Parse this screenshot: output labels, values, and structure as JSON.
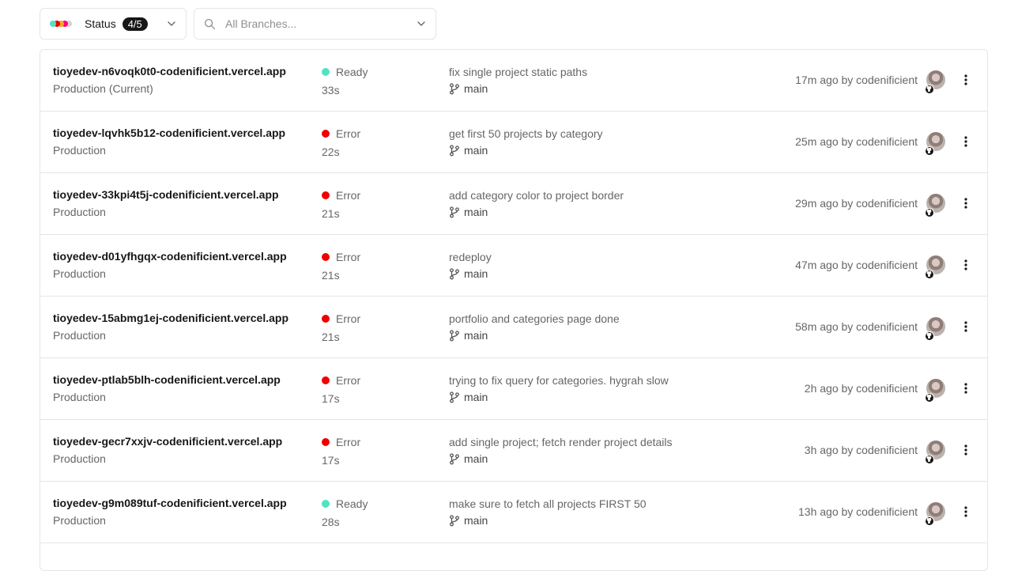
{
  "filters": {
    "status": {
      "label": "Status",
      "count": "4/5",
      "dot_colors": [
        "#50e3c2",
        "#ee0000",
        "#f5a623",
        "#ff0080",
        "#d4d4d4"
      ]
    },
    "branch": {
      "placeholder": "All Branches...",
      "icon": "search-icon"
    }
  },
  "colors": {
    "ready": "#50e3c2",
    "error": "#ee0000"
  },
  "deployments": [
    {
      "url": "tioyedev-n6voqk0t0-codenificient.vercel.app",
      "environment": "Production (Current)",
      "status": "Ready",
      "duration": "33s",
      "commit": "fix single project static paths",
      "branch": "main",
      "meta": "17m ago by codenificient"
    },
    {
      "url": "tioyedev-lqvhk5b12-codenificient.vercel.app",
      "environment": "Production",
      "status": "Error",
      "duration": "22s",
      "commit": "get first 50 projects by category",
      "branch": "main",
      "meta": "25m ago by codenificient"
    },
    {
      "url": "tioyedev-33kpi4t5j-codenificient.vercel.app",
      "environment": "Production",
      "status": "Error",
      "duration": "21s",
      "commit": "add category color to project border",
      "branch": "main",
      "meta": "29m ago by codenificient"
    },
    {
      "url": "tioyedev-d01yfhgqx-codenificient.vercel.app",
      "environment": "Production",
      "status": "Error",
      "duration": "21s",
      "commit": "redeploy",
      "branch": "main",
      "meta": "47m ago by codenificient"
    },
    {
      "url": "tioyedev-15abmg1ej-codenificient.vercel.app",
      "environment": "Production",
      "status": "Error",
      "duration": "21s",
      "commit": "portfolio and categories page done",
      "branch": "main",
      "meta": "58m ago by codenificient"
    },
    {
      "url": "tioyedev-ptlab5blh-codenificient.vercel.app",
      "environment": "Production",
      "status": "Error",
      "duration": "17s",
      "commit": "trying to fix query for categories. hygrah slow",
      "branch": "main",
      "meta": "2h ago by codenificient"
    },
    {
      "url": "tioyedev-gecr7xxjv-codenificient.vercel.app",
      "environment": "Production",
      "status": "Error",
      "duration": "17s",
      "commit": "add single project; fetch render project details",
      "branch": "main",
      "meta": "3h ago by codenificient"
    },
    {
      "url": "tioyedev-g9m089tuf-codenificient.vercel.app",
      "environment": "Production",
      "status": "Ready",
      "duration": "28s",
      "commit": "make sure to fetch all projects FIRST 50",
      "branch": "main",
      "meta": "13h ago by codenificient"
    }
  ]
}
